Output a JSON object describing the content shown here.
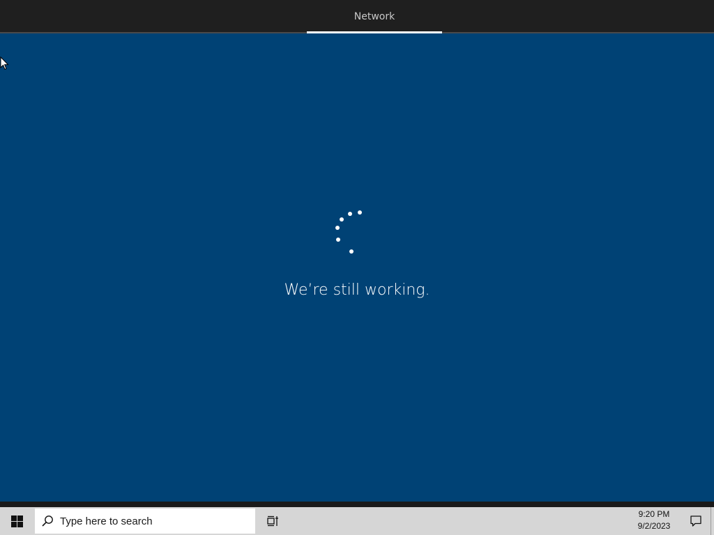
{
  "topbar": {
    "tab_label": "Network"
  },
  "main": {
    "status_text": "We’re still working."
  },
  "taskbar": {
    "start_icon": "windows-logo-icon",
    "search_icon": "search-icon",
    "search_placeholder": "Type here to search",
    "taskview_icon": "task-view-icon",
    "clock_time": "9:20 PM",
    "clock_date": "9/2/2023",
    "notification_icon": "action-center-icon"
  },
  "colors": {
    "background": "#004275",
    "topbar": "#1f1f1f",
    "taskbar": "#d6d6d6",
    "tab_underline": "#ffffff"
  }
}
